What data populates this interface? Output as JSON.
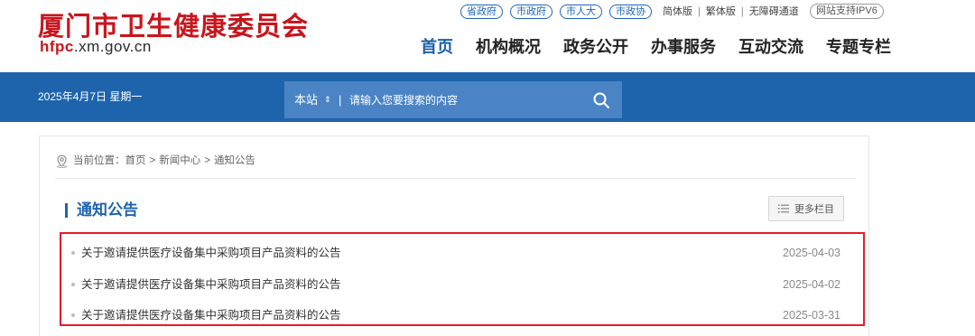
{
  "header": {
    "site_title": "厦门市卫生健康委员会",
    "domain_accent": "hfpc",
    "domain_rest": ".xm.gov.cn",
    "gov_links": [
      "省政府",
      "市政府",
      "市人大",
      "市政协"
    ],
    "util_links": [
      "简体版",
      "繁体版",
      "无障碍通道"
    ],
    "ipv6_label": "网站支持IPV6",
    "nav": [
      {
        "label": "首页",
        "active": true
      },
      {
        "label": "机构概况"
      },
      {
        "label": "政务公开"
      },
      {
        "label": "办事服务"
      },
      {
        "label": "互动交流"
      },
      {
        "label": "专题专栏"
      }
    ]
  },
  "banner": {
    "date": "2025年4月7日 星期一",
    "search": {
      "scope": "本站",
      "scope_arrow": "⇕",
      "separator": "|",
      "placeholder": "请输入您要搜索的内容",
      "icon": "search-icon"
    }
  },
  "content": {
    "breadcrumb": {
      "icon": "location-icon",
      "prefix": "当前位置：",
      "items": [
        "首页",
        "新闻中心",
        "通知公告"
      ],
      "separator": ">"
    },
    "section_title": "通知公告",
    "more_button": {
      "label": "更多栏目",
      "icon": "list-icon"
    },
    "news": [
      {
        "title": "关于邀请提供医疗设备集中采购项目产品资料的公告",
        "date": "2025-04-03"
      },
      {
        "title": "关于邀请提供医疗设备集中采购项目产品资料的公告",
        "date": "2025-04-02"
      },
      {
        "title": "关于邀请提供医疗设备集中采购项目产品资料的公告",
        "date": "2025-03-31"
      }
    ]
  },
  "colors": {
    "brand_red": "#c8161d",
    "brand_blue": "#1e64ad",
    "search_bg": "#4a84c4",
    "highlight_border": "#e21d2a"
  }
}
